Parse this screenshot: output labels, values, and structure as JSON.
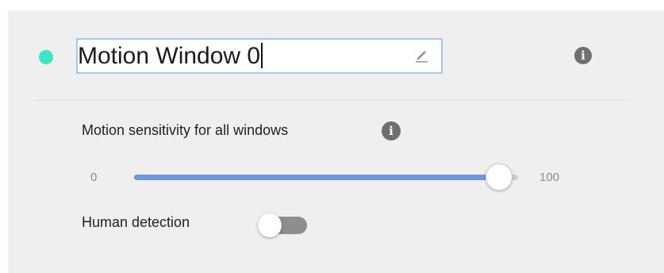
{
  "window": {
    "name_value": "Motion Window 0",
    "status_color": "#3ee6c9"
  },
  "icons": {
    "edit": "pencil-icon",
    "info": "info-icon"
  },
  "sensitivity": {
    "label": "Motion sensitivity for all windows",
    "min_label": "0",
    "max_label": "100",
    "value": 95
  },
  "human_detection": {
    "label": "Human detection",
    "enabled": false
  },
  "colors": {
    "accent": "#6e97d6",
    "panel_bg": "#efefef",
    "icon_gray": "#6f6f6f"
  }
}
